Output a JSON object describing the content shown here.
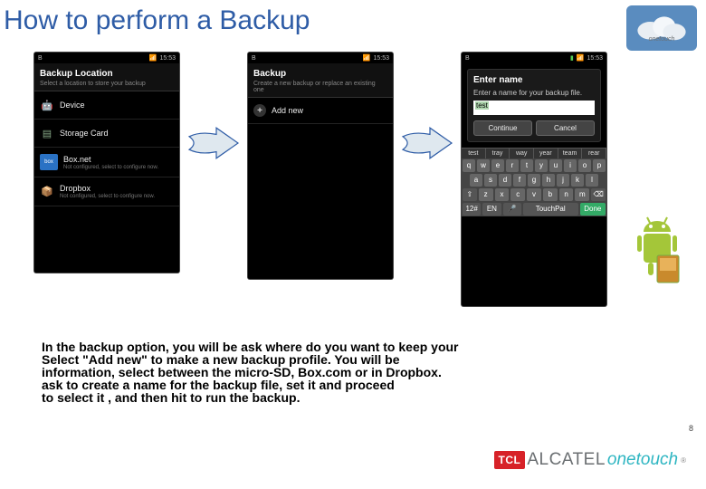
{
  "title": "How to perform a Backup",
  "onetouch_badge": "onetouch",
  "statusbar": {
    "left_icon": "B",
    "time": "15:53"
  },
  "screen1": {
    "title": "Backup Location",
    "subtitle": "Select a location to store your backup",
    "items": [
      {
        "icon": "android",
        "label": "Device",
        "sub": ""
      },
      {
        "icon": "sd",
        "label": "Storage Card",
        "sub": ""
      },
      {
        "icon": "box",
        "label": "Box.net",
        "sub": "Not configured, select to configure now."
      },
      {
        "icon": "dropbox",
        "label": "Dropbox",
        "sub": "Not configured, select to configure now."
      }
    ]
  },
  "screen2": {
    "title": "Backup",
    "subtitle": "Create a new backup or replace an existing one",
    "addnew": "Add new"
  },
  "screen3": {
    "dialog_title": "Enter name",
    "dialog_msg": "Enter a name for your backup file.",
    "input_value": "test",
    "continue": "Continue",
    "cancel": "Cancel",
    "suggestions": [
      "test",
      "tray",
      "way",
      "year",
      "team",
      "rear"
    ],
    "kbd_rows": [
      [
        "q",
        "w",
        "e",
        "r",
        "t",
        "y",
        "u",
        "i",
        "o",
        "p"
      ],
      [
        "a",
        "s",
        "d",
        "f",
        "g",
        "h",
        "j",
        "k",
        "l"
      ],
      [
        "⇧",
        "z",
        "x",
        "c",
        "v",
        "b",
        "n",
        "m",
        "⌫"
      ]
    ],
    "kbd_bottom": {
      "sym": "12#",
      "lang": "EN",
      "mic": "🎤",
      "brand": "TouchPal",
      "done": "Done"
    }
  },
  "body_lines": [
    "In the backup option, you will be  ask where do you want to keep your",
    "Select \"Add new\" to make a new backup profile. You will be",
    "information, select between the micro-SD, Box.com or in Dropbox.",
    "ask  to create a name for the backup file, set it and proceed",
    "to  select it , and then  hit to run the backup."
  ],
  "page_number": "8",
  "footer": {
    "tcl": "TCL",
    "alcatel": "ALCATEL",
    "onetouch": "onetouch",
    "reg": "®"
  }
}
